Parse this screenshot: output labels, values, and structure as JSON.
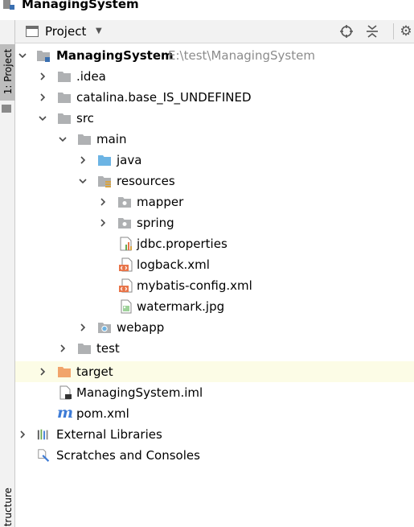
{
  "window": {
    "title": "ManagingSystem"
  },
  "left_strip": {
    "project_tab": "1: Project",
    "structure_tab": "Structure"
  },
  "panel": {
    "view_label": "Project"
  },
  "tree": {
    "root": {
      "label": "ManagingSystem",
      "path": "E:\\test\\ManagingSystem"
    },
    "idea": ".idea",
    "catalina": "catalina.base_IS_UNDEFINED",
    "src": "src",
    "main": "main",
    "java": "java",
    "resources": "resources",
    "mapper": "mapper",
    "spring": "spring",
    "jdbc": "jdbc.properties",
    "logback": "logback.xml",
    "mybatis": "mybatis-config.xml",
    "watermark": "watermark.jpg",
    "webapp": "webapp",
    "test": "test",
    "target": "target",
    "iml": "ManagingSystem.iml",
    "pom": "pom.xml",
    "external": "External Libraries",
    "scratches": "Scratches and Consoles"
  },
  "colors": {
    "folder": "#afb1b3",
    "source_folder": "#6cb4e4",
    "excluded_folder": "#f1a46b",
    "selection": "#fcfce6",
    "xml_orange": "#e8754a",
    "path_gray": "#8c8c8c"
  }
}
